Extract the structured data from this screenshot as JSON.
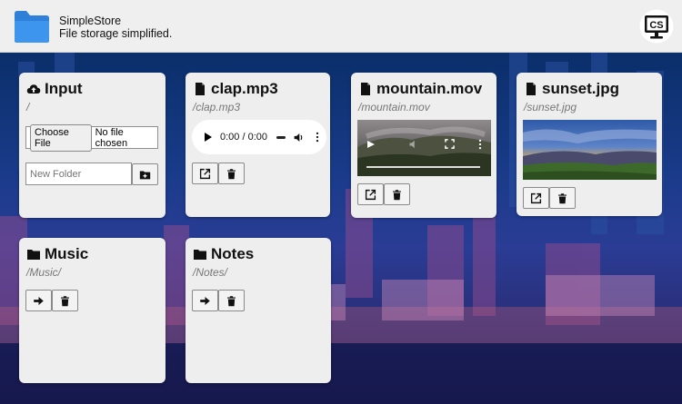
{
  "header": {
    "app_name": "SimpleStore",
    "tagline": "File storage simplified.",
    "badge_text": "CS",
    "folder_icon": "folder-icon",
    "accent": "#3a8ee6"
  },
  "input_card": {
    "title": "Input",
    "icon": "cloud-upload-icon",
    "path": "/",
    "choose_label": "Choose File",
    "file_status": "No file chosen",
    "folder_placeholder": "New Folder",
    "add_folder_icon": "folder-plus-icon"
  },
  "files": [
    {
      "title": "clap.mp3",
      "path": "/clap.mp3",
      "kind": "audio",
      "time": "0:00 / 0:00"
    },
    {
      "title": "mountain.mov",
      "path": "/mountain.mov",
      "kind": "video"
    },
    {
      "title": "sunset.jpg",
      "path": "/sunset.jpg",
      "kind": "image"
    }
  ],
  "folders": [
    {
      "title": "Music",
      "path": "/Music/"
    },
    {
      "title": "Notes",
      "path": "/Notes/"
    }
  ]
}
